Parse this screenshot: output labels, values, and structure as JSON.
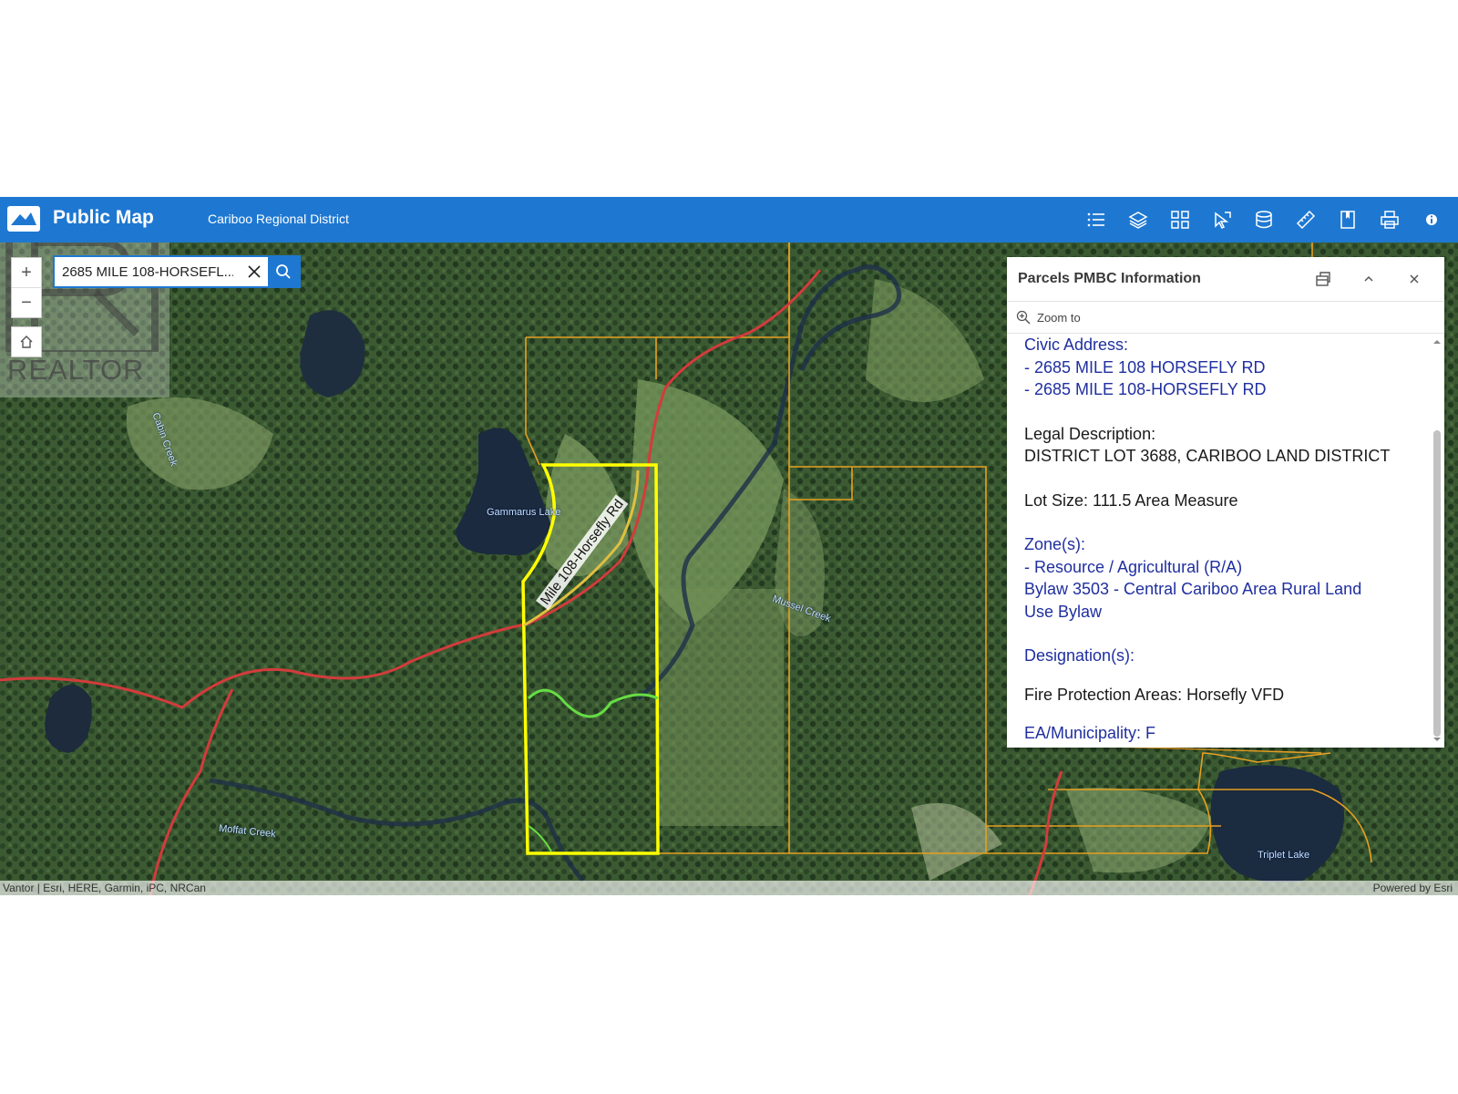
{
  "header": {
    "app_title": "Public Map",
    "org_name": "Cariboo Regional District",
    "tools": [
      "list-icon",
      "layers-icon",
      "basemap-gallery-icon",
      "select-icon",
      "data-icon",
      "measure-icon",
      "bookmark-icon",
      "print-icon",
      "info-icon"
    ]
  },
  "search": {
    "value": "2685 MILE 108-HORSEFL..."
  },
  "watermark": {
    "text": "REALTOR"
  },
  "map": {
    "labels": {
      "lake1": "Gammarus Lake",
      "road": "Mile 108-Horsefly Rd",
      "creek1": "Mussel Creek",
      "creek2": "Moffat Creek",
      "lake2": "Triplet Lake",
      "creek3": "Cabin Creek"
    },
    "attribution_left": "Vantor | Esri, HERE, Garmin, iPC, NRCan",
    "attribution_right": "Powered by Esri"
  },
  "popup": {
    "title": "Parcels PMBC Information",
    "zoom_label": "Zoom to",
    "civic_label": "Civic Address:",
    "civic_1": "- 2685 MILE 108 HORSEFLY RD",
    "civic_2": "- 2685 MILE 108-HORSEFLY RD",
    "legal_label": "Legal Description:",
    "legal_value": "DISTRICT LOT 3688, CARIBOO LAND DISTRICT",
    "lot_size": "Lot Size: 111.5 Area Measure",
    "zone_label": "Zone(s):",
    "zone_1": "- Resource / Agricultural (R/A)",
    "zone_2": "Bylaw 3503 - Central Cariboo Area Rural Land",
    "zone_3": "Use Bylaw",
    "designation_label": "Designation(s):",
    "fire": "Fire Protection Areas: Horsefly VFD",
    "ea": "EA/Municipality: F"
  },
  "colors": {
    "header": "#1e78d2",
    "parcel_outline": "#e8a020",
    "selected_parcel": "#ffff00",
    "road": "#d23c3c"
  }
}
